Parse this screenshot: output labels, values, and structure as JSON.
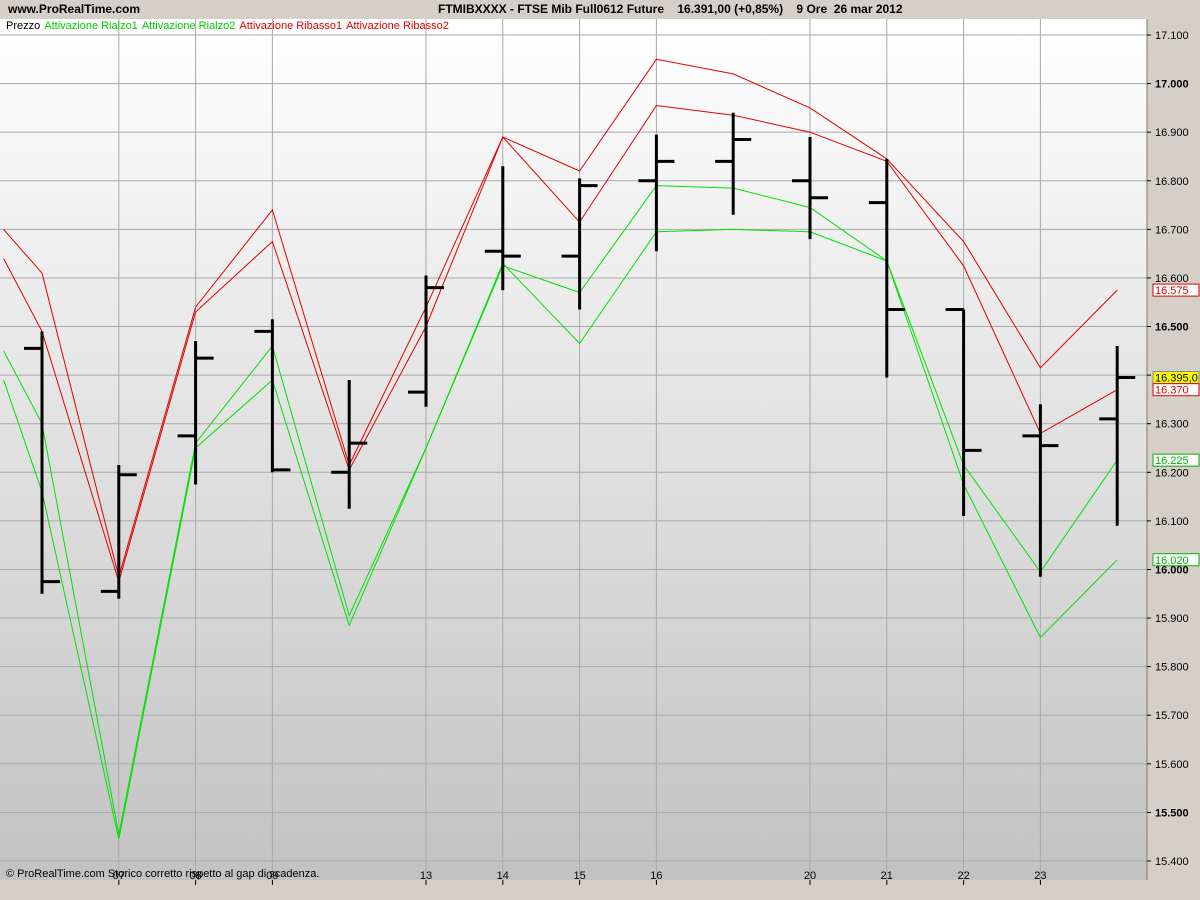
{
  "header": {
    "site": "www.ProRealTime.com",
    "instrument": "FTMIBXXXX - FTSE Mib Full0612 Future    16.391,00 (+0,85%)    9 Ore  26 mar 2012"
  },
  "footer": {
    "text": "© ProRealTime.com  Storico corretto rispetto al gap di scadenza."
  },
  "legend": [
    {
      "label": "Prezzo",
      "color": "#000000"
    },
    {
      "label": "Attivazione Rialzo1",
      "color": "#00cc00"
    },
    {
      "label": "Attivazione Rialzo2",
      "color": "#00cc00"
    },
    {
      "label": "Attivazione Ribasso1",
      "color": "#dd0000"
    },
    {
      "label": "Attivazione Ribasso2",
      "color": "#dd0000"
    }
  ],
  "chart_data": {
    "type": "ohlc",
    "ylim": [
      15360,
      17120
    ],
    "y_ticks": [
      {
        "v": 17100,
        "label": "17.100",
        "bold": false
      },
      {
        "v": 17000,
        "label": "17.000",
        "bold": true
      },
      {
        "v": 16900,
        "label": "16.900",
        "bold": false
      },
      {
        "v": 16800,
        "label": "16.800",
        "bold": false
      },
      {
        "v": 16700,
        "label": "16.700",
        "bold": false
      },
      {
        "v": 16600,
        "label": "16.600",
        "bold": false
      },
      {
        "v": 16500,
        "label": "16.500",
        "bold": true
      },
      {
        "v": 16400,
        "label": "16.400",
        "bold": false
      },
      {
        "v": 16300,
        "label": "16.300",
        "bold": false
      },
      {
        "v": 16200,
        "label": "16.200",
        "bold": false
      },
      {
        "v": 16100,
        "label": "16.100",
        "bold": false
      },
      {
        "v": 16000,
        "label": "16.000",
        "bold": true
      },
      {
        "v": 15900,
        "label": "15.900",
        "bold": false
      },
      {
        "v": 15800,
        "label": "15.800",
        "bold": false
      },
      {
        "v": 15700,
        "label": "15.700",
        "bold": false
      },
      {
        "v": 15600,
        "label": "15.600",
        "bold": false
      },
      {
        "v": 15500,
        "label": "15.500",
        "bold": true
      },
      {
        "v": 15400,
        "label": "15.400",
        "bold": false
      }
    ],
    "x_labels": [
      {
        "i": 1,
        "label": "07"
      },
      {
        "i": 2,
        "label": "08"
      },
      {
        "i": 3,
        "label": "09"
      },
      {
        "i": 5,
        "label": "13"
      },
      {
        "i": 6,
        "label": "14"
      },
      {
        "i": 7,
        "label": "15"
      },
      {
        "i": 8,
        "label": "16"
      },
      {
        "i": 10,
        "label": "20"
      },
      {
        "i": 11,
        "label": "21"
      },
      {
        "i": 12,
        "label": "22"
      },
      {
        "i": 13,
        "label": "23"
      }
    ],
    "bars": [
      {
        "o": 16455,
        "h": 16490,
        "l": 15950,
        "c": 15975
      },
      {
        "o": 15955,
        "h": 16215,
        "l": 15940,
        "c": 16195
      },
      {
        "o": 16275,
        "h": 16470,
        "l": 16175,
        "c": 16435
      },
      {
        "o": 16490,
        "h": 16515,
        "l": 16200,
        "c": 16205
      },
      {
        "o": 16200,
        "h": 16390,
        "l": 16125,
        "c": 16260
      },
      {
        "o": 16365,
        "h": 16605,
        "l": 16335,
        "c": 16580
      },
      {
        "o": 16655,
        "h": 16830,
        "l": 16575,
        "c": 16645
      },
      {
        "o": 16645,
        "h": 16805,
        "l": 16535,
        "c": 16790
      },
      {
        "o": 16800,
        "h": 16895,
        "l": 16655,
        "c": 16840
      },
      {
        "o": 16840,
        "h": 16940,
        "l": 16730,
        "c": 16885
      },
      {
        "o": 16800,
        "h": 16890,
        "l": 16680,
        "c": 16765
      },
      {
        "o": 16755,
        "h": 16845,
        "l": 16395,
        "c": 16535
      },
      {
        "o": 16535,
        "h": 16535,
        "l": 16110,
        "c": 16245
      },
      {
        "o": 16275,
        "h": 16340,
        "l": 15985,
        "c": 16255
      },
      {
        "o": 16310,
        "h": 16460,
        "l": 16090,
        "c": 16395
      }
    ],
    "series": [
      {
        "name": "Attivazione Rialzo1",
        "color": "#00e000",
        "x": [
          -0.5,
          0,
          1,
          2,
          3,
          4,
          5,
          6,
          7,
          8,
          9,
          10,
          11,
          12,
          13,
          14
        ],
        "values": [
          16450,
          16300,
          15455,
          16260,
          16460,
          15905,
          16250,
          16625,
          16570,
          16790,
          16785,
          16745,
          16635,
          16215,
          15995,
          16225
        ]
      },
      {
        "name": "Attivazione Rialzo2",
        "color": "#00e000",
        "x": [
          -0.5,
          0,
          1,
          2,
          3,
          4,
          5,
          6,
          7,
          8,
          9,
          10,
          11,
          12,
          13,
          14
        ],
        "values": [
          16390,
          16160,
          15445,
          16250,
          16390,
          15885,
          16250,
          16630,
          16465,
          16695,
          16700,
          16695,
          16635,
          16175,
          15860,
          16020
        ]
      },
      {
        "name": "Attivazione Ribasso1",
        "color": "#e00000",
        "x": [
          -0.5,
          0,
          1,
          2,
          3,
          4,
          5,
          6,
          7,
          8,
          9,
          10,
          11,
          12,
          13,
          14
        ],
        "values": [
          16700,
          16610,
          15985,
          16540,
          16740,
          16215,
          16540,
          16890,
          16820,
          17050,
          17020,
          16950,
          16845,
          16675,
          16415,
          16575
        ]
      },
      {
        "name": "Attivazione Ribasso2",
        "color": "#e00000",
        "x": [
          -0.5,
          0,
          1,
          2,
          3,
          4,
          5,
          6,
          7,
          8,
          9,
          10,
          11,
          12,
          13,
          14
        ],
        "values": [
          16640,
          16490,
          15975,
          16530,
          16675,
          16205,
          16500,
          16890,
          16715,
          16955,
          16935,
          16900,
          16840,
          16625,
          16280,
          16370
        ]
      }
    ],
    "price_tags": [
      {
        "value": 16575,
        "label": "16.575",
        "fg": "#dd0000",
        "bg": "#ffffff",
        "border": "#dd0000"
      },
      {
        "value": 16395,
        "label": "16.395,0",
        "fg": "#000000",
        "bg": "#ffff00",
        "border": "#888888"
      },
      {
        "value": 16370,
        "label": "16.370",
        "fg": "#dd0000",
        "bg": "#ffffff",
        "border": "#dd0000"
      },
      {
        "value": 16225,
        "label": "16.225",
        "fg": "#00b000",
        "bg": "#ffffff",
        "border": "#00b000"
      },
      {
        "value": 16020,
        "label": "16.020",
        "fg": "#00b000",
        "bg": "#ffffff",
        "border": "#00b000"
      }
    ]
  }
}
